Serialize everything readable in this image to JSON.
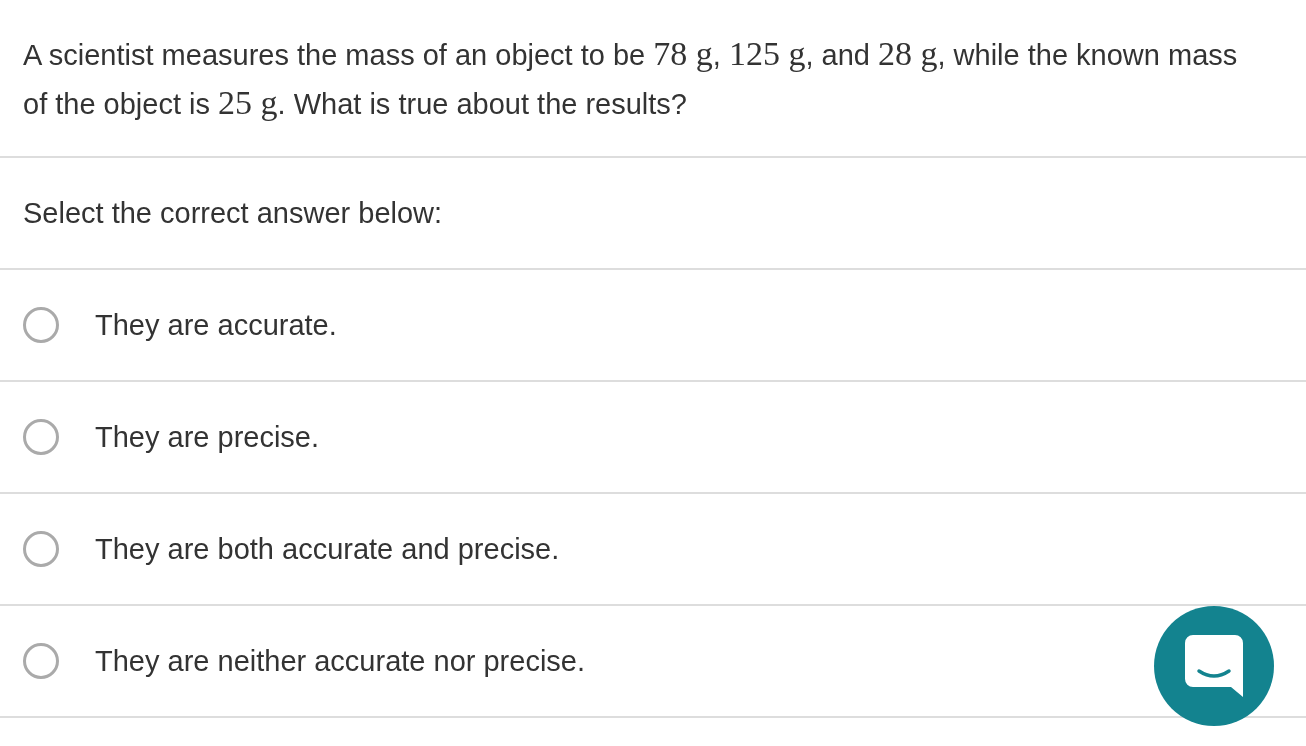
{
  "question": {
    "segments": [
      {
        "kind": "text",
        "text": "A scientist measures the mass of an object to be "
      },
      {
        "kind": "math",
        "text": "78 g"
      },
      {
        "kind": "text",
        "text": ", "
      },
      {
        "kind": "math",
        "text": "125 g"
      },
      {
        "kind": "text",
        "text": ", and "
      },
      {
        "kind": "math",
        "text": "28 g"
      },
      {
        "kind": "text",
        "text": ", while the known mass of the object is "
      },
      {
        "kind": "math",
        "text": "25 g"
      },
      {
        "kind": "text",
        "text": ". What is true about the results?"
      }
    ]
  },
  "instruction": "Select the correct answer below:",
  "options": [
    {
      "label": "They are accurate.",
      "selected": false
    },
    {
      "label": "They are precise.",
      "selected": false
    },
    {
      "label": "They are both accurate and precise.",
      "selected": false
    },
    {
      "label": "They are neither accurate nor precise.",
      "selected": false
    }
  ]
}
